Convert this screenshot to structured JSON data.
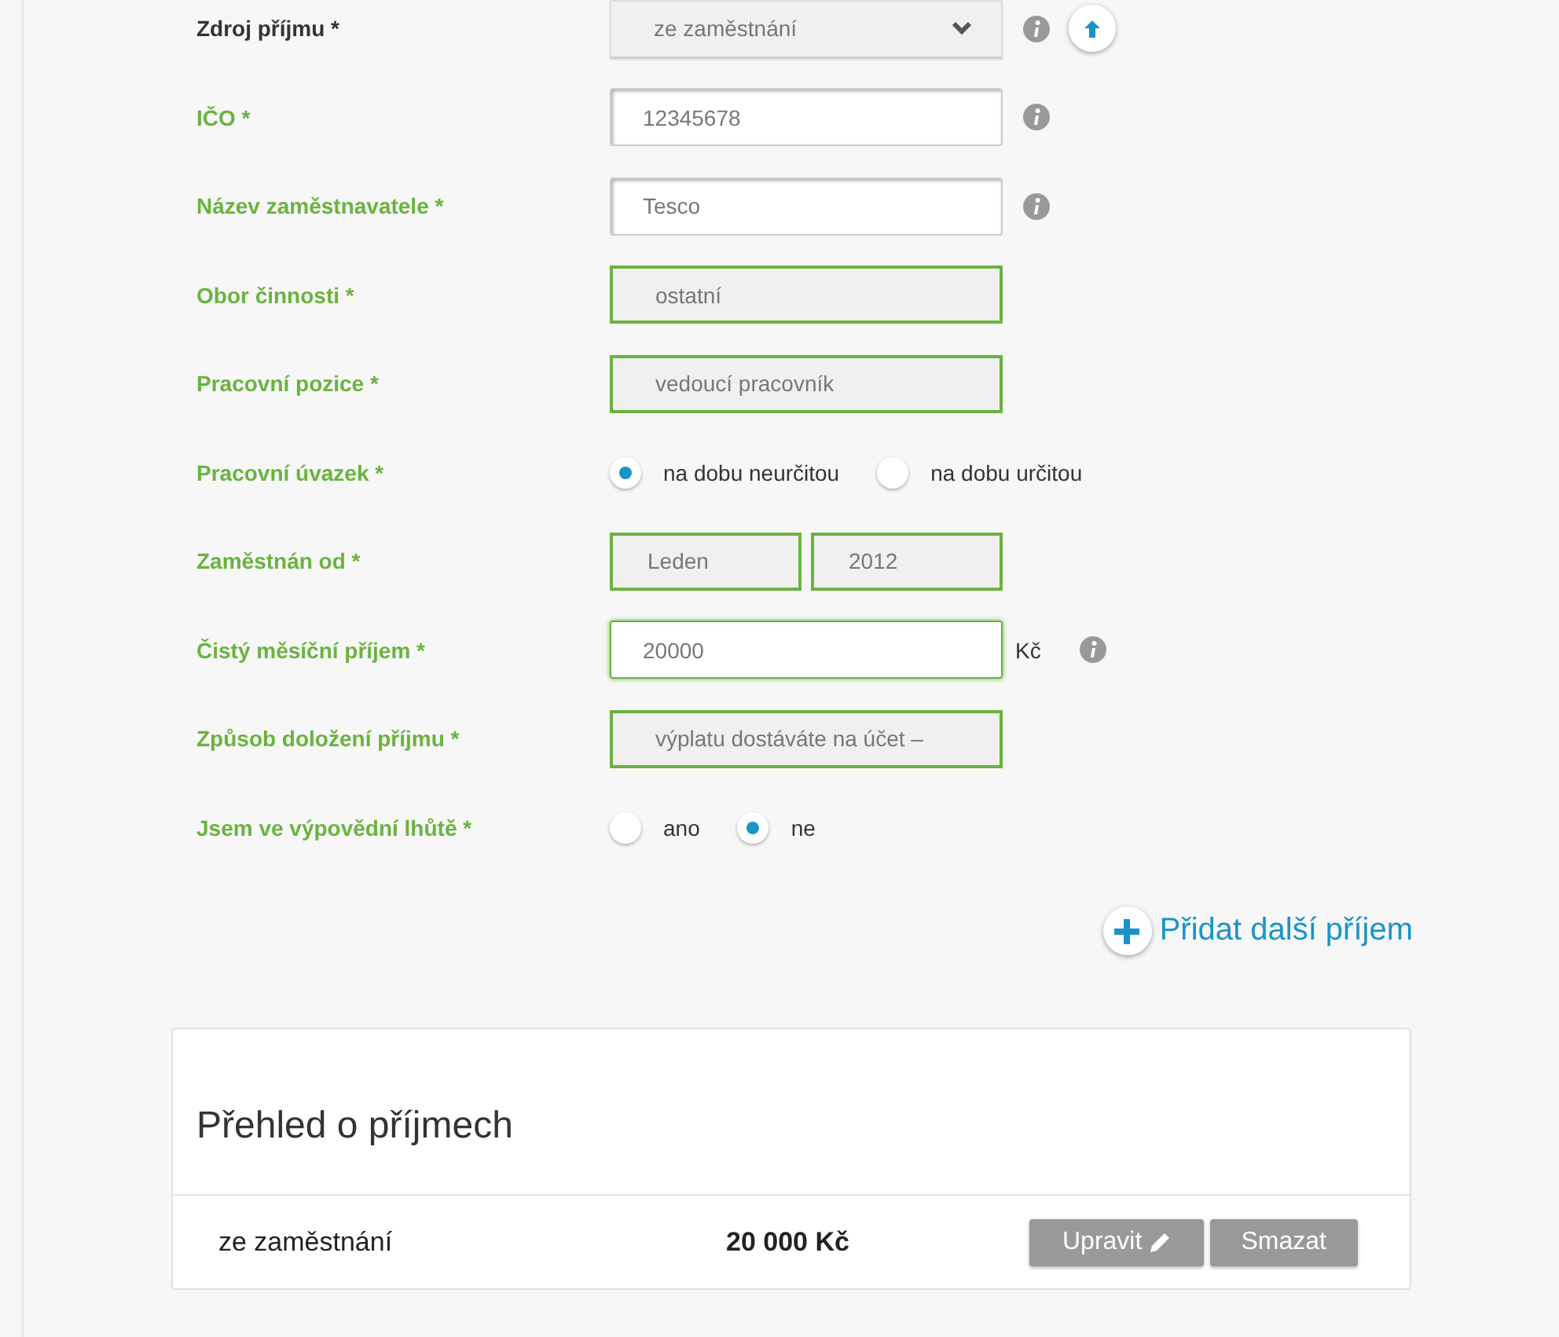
{
  "form": {
    "rows": [
      {
        "label": "Zdroj příjmu *",
        "valid": false,
        "kind": "select",
        "info": true,
        "fields": [
          {
            "value": "ze zaměstnání",
            "valid": false
          }
        ]
      },
      {
        "label": "IČO *",
        "valid": true,
        "kind": "input",
        "info": true,
        "fields": [
          {
            "value": "12345678",
            "valid": false
          }
        ]
      },
      {
        "label": "Název zaměstnavatele *",
        "valid": true,
        "kind": "input",
        "info": true,
        "fields": [
          {
            "value": "Tesco",
            "valid": false
          }
        ]
      },
      {
        "label": "Obor činnosti *",
        "valid": true,
        "kind": "select",
        "info": false,
        "fields": [
          {
            "value": "ostatní",
            "valid": true
          }
        ]
      },
      {
        "label": "Pracovní pozice *",
        "valid": true,
        "kind": "select",
        "info": false,
        "fields": [
          {
            "value": "vedoucí pracovník",
            "valid": true
          }
        ]
      },
      {
        "label": "Pracovní úvazek *",
        "valid": true,
        "kind": "radio",
        "info": false,
        "options": [
          {
            "label": "na dobu neurčitou",
            "selected": true
          },
          {
            "label": "na dobu určitou",
            "selected": false
          }
        ]
      },
      {
        "label": "Zaměstnán od *",
        "valid": true,
        "kind": "select",
        "info": false,
        "fields": [
          {
            "value": "Leden",
            "valid": true
          },
          {
            "value": "2012",
            "valid": true
          }
        ]
      },
      {
        "label": "Čistý měsíční příjem *",
        "valid": true,
        "kind": "input",
        "info": true,
        "unit": "Kč",
        "fields": [
          {
            "value": "20000",
            "valid": true
          }
        ]
      },
      {
        "label": "Způsob doložení příjmu *",
        "valid": true,
        "kind": "select",
        "info": false,
        "fields": [
          {
            "value": "výplatu dostáváte na účet –",
            "valid": true
          }
        ]
      },
      {
        "label": "Jsem ve výpovědní lhůtě *",
        "valid": true,
        "kind": "radio",
        "info": false,
        "options": [
          {
            "label": "ano",
            "selected": false
          },
          {
            "label": "ne",
            "selected": true
          }
        ]
      }
    ],
    "add_link": "Přidat další příjem"
  },
  "overview": {
    "title": "Přehled o příjmech",
    "rows": [
      {
        "source": "ze zaměstnání",
        "amount": "20 000 Kč",
        "buttons": [
          "Upravit",
          "Smazat"
        ]
      }
    ]
  }
}
